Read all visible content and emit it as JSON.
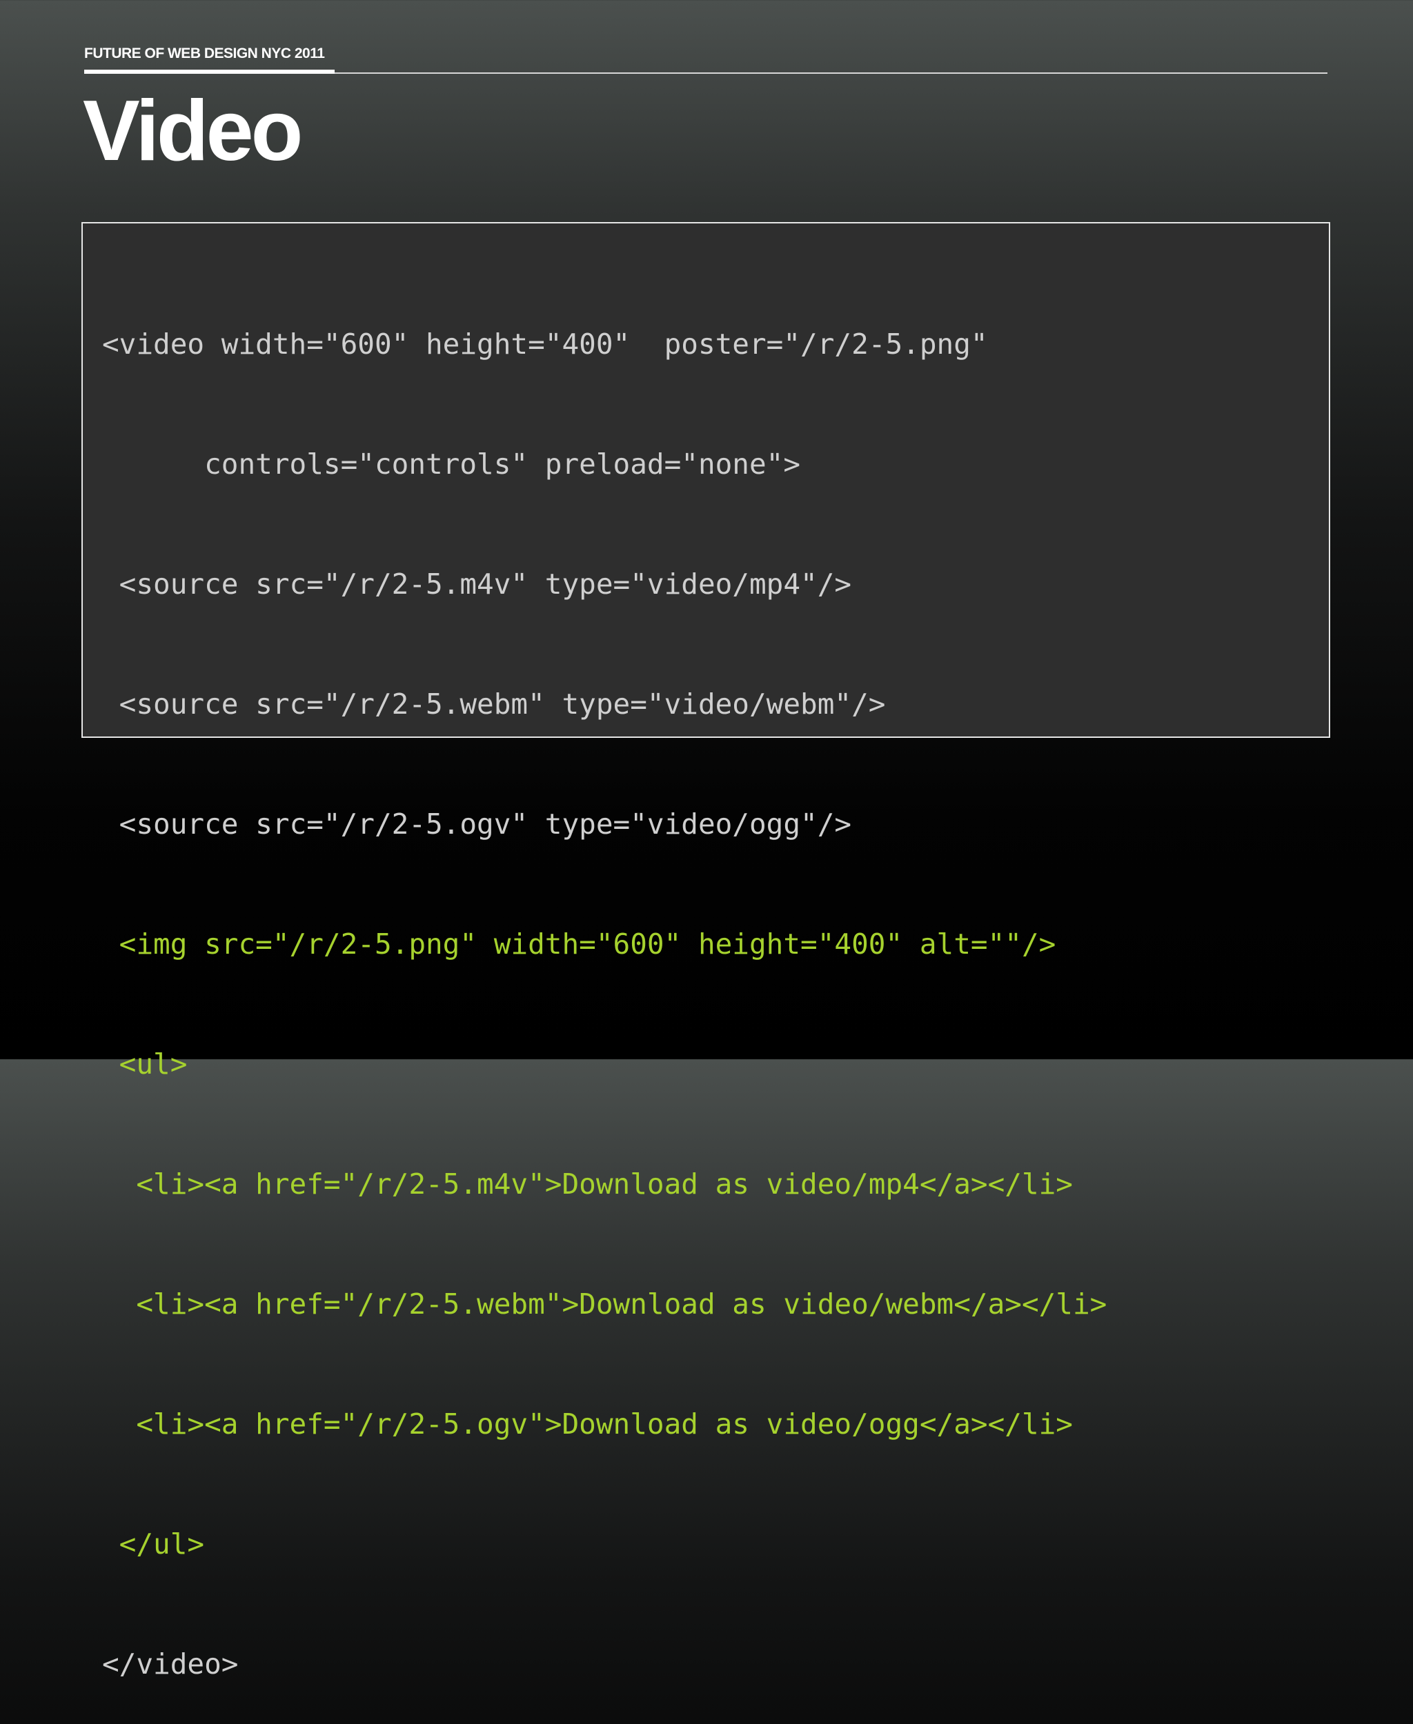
{
  "header": {
    "label": "FUTURE OF WEB DESIGN NYC 2011"
  },
  "slide": {
    "title": "Video"
  },
  "code": {
    "lines": [
      {
        "text": "<video width=\"600\" height=\"400\"  poster=\"/r/2-5.png\"",
        "style": "plain"
      },
      {
        "text": "      controls=\"controls\" preload=\"none\">",
        "style": "plain"
      },
      {
        "text": " <source src=\"/r/2-5.m4v\" type=\"video/mp4\"/>",
        "style": "plain"
      },
      {
        "text": " <source src=\"/r/2-5.webm\" type=\"video/webm\"/>",
        "style": "plain"
      },
      {
        "text": " <source src=\"/r/2-5.ogv\" type=\"video/ogg\"/>",
        "style": "plain"
      },
      {
        "text": " <img src=\"/r/2-5.png\" width=\"600\" height=\"400\" alt=\"\"/>",
        "style": "highlight"
      },
      {
        "text": " <ul>",
        "style": "highlight"
      },
      {
        "text": "  <li><a href=\"/r/2-5.m4v\">Download as video/mp4</a></li>",
        "style": "highlight"
      },
      {
        "text": "  <li><a href=\"/r/2-5.webm\">Download as video/webm</a></li>",
        "style": "highlight"
      },
      {
        "text": "  <li><a href=\"/r/2-5.ogv\">Download as video/ogg</a></li>",
        "style": "highlight"
      },
      {
        "text": " </ul>",
        "style": "highlight"
      },
      {
        "text": "</video>",
        "style": "plain"
      }
    ]
  },
  "colors": {
    "code_plain": "#cfcfcf",
    "code_highlight": "#a6d22e",
    "code_background": "#2e2e2e",
    "title_text": "#ffffff"
  }
}
